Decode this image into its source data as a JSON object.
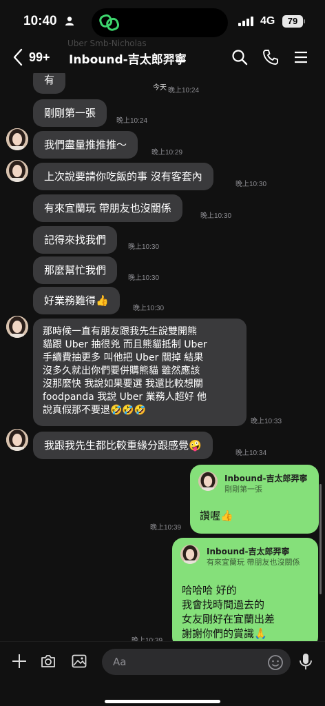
{
  "status_bar": {
    "time": "10:40",
    "network": "4G",
    "battery": "79"
  },
  "header": {
    "faded_name": "Uber Smb-Nicholas",
    "unread": "99+",
    "title": "Inbound-吉太郎羿寧",
    "icons": [
      "back-chevron-icon",
      "search-icon",
      "phone-icon",
      "menu-icon"
    ]
  },
  "messages": [
    {
      "text": "有",
      "time": "晚上10:24",
      "today_label": "今天"
    },
    {
      "text": "剛剛第一張",
      "time": "晚上10:24"
    },
    {
      "text": "我們盡量推推推～",
      "time": "晚上10:29"
    },
    {
      "text": "上次說要請你吃飯的事 沒有客套內",
      "time": "晚上10:30"
    },
    {
      "text": "有來宜蘭玩 帶朋友也沒關係",
      "time": "晚上10:30"
    },
    {
      "text": "記得來找我們",
      "time": "晚上10:30"
    },
    {
      "text": "那麼幫忙我們",
      "time": "晚上10:30"
    },
    {
      "text": "好業務難得👍",
      "time": "晚上10:30"
    },
    {
      "text": "那時候一直有朋友跟我先生說雙開熊\n貓跟 Uber 抽很兇 而且熊貓抵制 Uber\n手續費抽更多 叫他把 Uber 關掉 結果\n沒多久就出你們要併購熊貓 雖然應該\n沒那麼快 我說如果要選 我還比較想關\nfoodpanda 我說 Uber 業務人超好 他\n說真假那不要退🤣🤣🤣",
      "time": "晚上10:33"
    },
    {
      "text": "我跟我先生都比較重緣分跟感覺🤪",
      "time": "晚上10:34"
    }
  ],
  "outgoing": [
    {
      "quote_name": "Inbound-吉太郎羿寧",
      "quote_text": "剛剛第一張",
      "text": "讚喔👍",
      "time": "晚上10:39"
    },
    {
      "quote_name": "Inbound-吉太郎羿寧",
      "quote_text": "有來宜蘭玩 帶朋友也沒關係",
      "text": "哈哈哈 好的\n我會找時間過去的\n女友剛好在宜蘭出差\n謝謝你們的賞識🙏",
      "time": "晚上10:39"
    }
  ],
  "composer": {
    "placeholder": "Aa",
    "icons": [
      "plus-icon",
      "camera-icon",
      "image-icon",
      "emoji-icon",
      "microphone-icon"
    ]
  },
  "colors": {
    "background": "#111111",
    "incoming_bubble": "#3a3a3c",
    "outgoing_bubble": "#85e07a",
    "timestamp": "#8e8e93"
  }
}
